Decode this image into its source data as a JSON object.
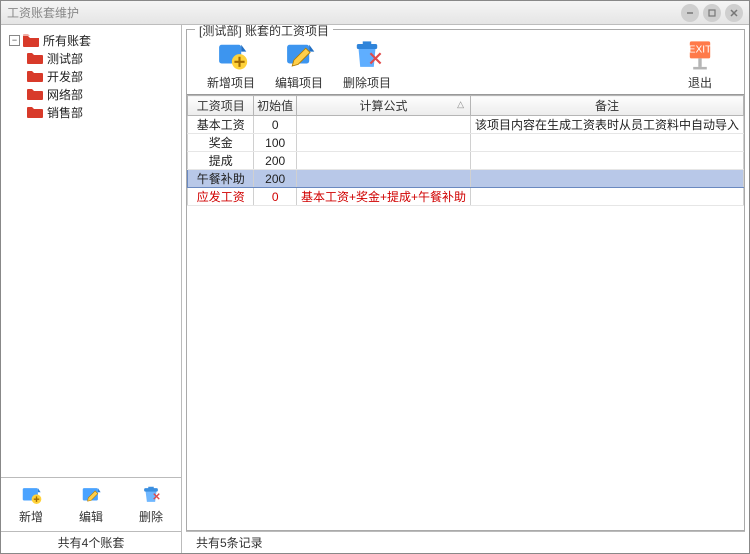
{
  "window": {
    "title": "工资账套维护"
  },
  "tree": {
    "root": {
      "label": "所有账套",
      "expander": "−"
    },
    "children": [
      {
        "label": "测试部"
      },
      {
        "label": "开发部"
      },
      {
        "label": "网络部"
      },
      {
        "label": "销售部"
      }
    ]
  },
  "left_toolbar": {
    "add": "新增",
    "edit": "编辑",
    "delete": "删除"
  },
  "left_status": "共有4个账套",
  "group_label": "[测试部] 账套的工资项目",
  "main_toolbar": {
    "add": "新增项目",
    "edit": "编辑项目",
    "delete": "删除项目",
    "exit": "退出"
  },
  "columns": {
    "name": "工资项目",
    "init": "初始值",
    "formula": "计算公式",
    "note": "备注"
  },
  "rows": [
    {
      "name": "基本工资",
      "init": "0",
      "formula": "",
      "note": "该项目内容在生成工资表时从员工资料中自动导入",
      "red": false,
      "selected": false
    },
    {
      "name": "奖金",
      "init": "100",
      "formula": "",
      "note": "",
      "red": false,
      "selected": false
    },
    {
      "name": "提成",
      "init": "200",
      "formula": "",
      "note": "",
      "red": false,
      "selected": false
    },
    {
      "name": "午餐补助",
      "init": "200",
      "formula": "",
      "note": "",
      "red": false,
      "selected": true
    },
    {
      "name": "应发工资",
      "init": "0",
      "formula": "基本工资+奖金+提成+午餐补助",
      "note": "",
      "red": true,
      "selected": false
    }
  ],
  "right_status": "共有5条记录",
  "icons": {
    "exit_badge": "EXIT"
  }
}
